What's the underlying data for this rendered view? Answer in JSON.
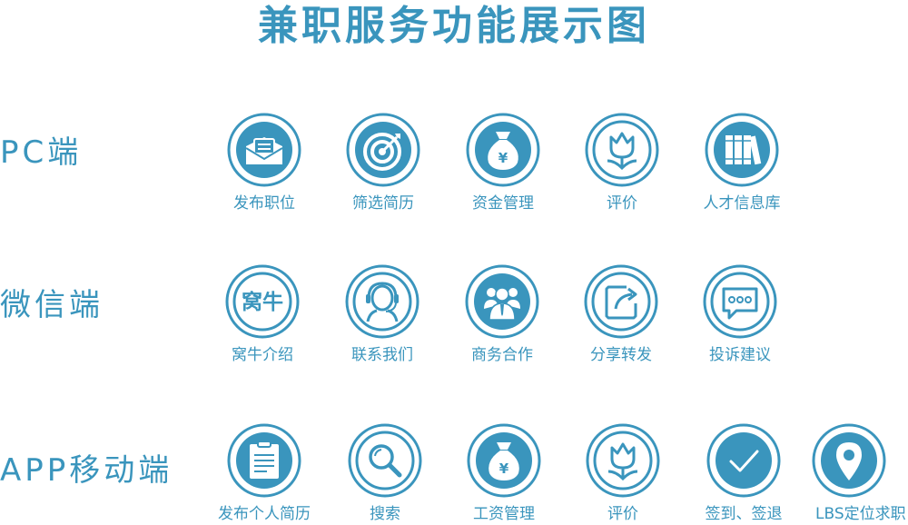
{
  "title": "兼职服务功能展示图",
  "rows": [
    {
      "label": "PC端",
      "items": [
        {
          "label": "发布职位",
          "icon": "mail-icon"
        },
        {
          "label": "筛选简历",
          "icon": "target-icon"
        },
        {
          "label": "资金管理",
          "icon": "money-bag-icon"
        },
        {
          "label": "评价",
          "icon": "tulip-icon"
        },
        {
          "label": "人才信息库",
          "icon": "books-icon"
        }
      ]
    },
    {
      "label": "微信端",
      "items": [
        {
          "label": "窝牛介绍",
          "icon": "brand-text-icon",
          "icon_text": "窝牛"
        },
        {
          "label": "联系我们",
          "icon": "headset-icon"
        },
        {
          "label": "商务合作",
          "icon": "business-team-icon"
        },
        {
          "label": "分享转发",
          "icon": "share-icon"
        },
        {
          "label": "投诉建议",
          "icon": "chat-bubble-icon"
        }
      ]
    },
    {
      "label": "APP移动端",
      "items": [
        {
          "label": "发布个人简历",
          "icon": "clipboard-icon"
        },
        {
          "label": "搜索",
          "icon": "magnifier-icon"
        },
        {
          "label": "工资管理",
          "icon": "money-bag-icon"
        },
        {
          "label": "评价",
          "icon": "tulip-icon"
        },
        {
          "label": "签到、签退",
          "icon": "check-icon"
        },
        {
          "label": "LBS定位求职",
          "icon": "location-pin-icon"
        }
      ]
    }
  ],
  "colors": {
    "primary": "#3a95bd",
    "white": "#ffffff"
  }
}
